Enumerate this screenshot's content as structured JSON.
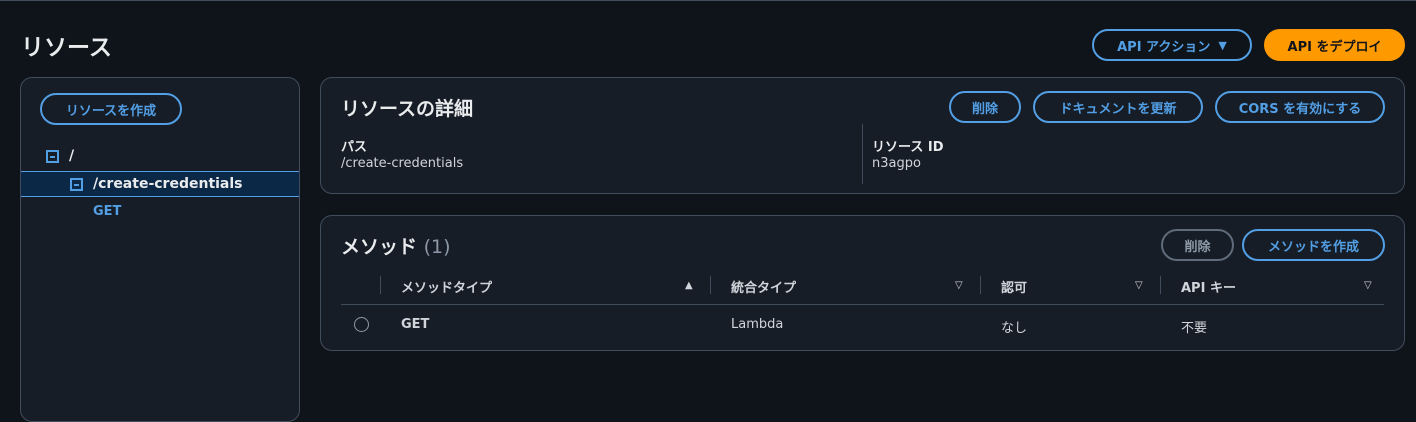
{
  "page": {
    "title": "リソース"
  },
  "actions": {
    "api_actions_label": "API アクション",
    "deploy_label": "API をデプロイ"
  },
  "sidebar": {
    "create_resource_label": "リソースを作成",
    "tree": [
      {
        "label": "/",
        "expandable": true
      },
      {
        "label": "/create-credentials",
        "expandable": true,
        "selected": true
      },
      {
        "label": "GET",
        "method": true
      }
    ]
  },
  "resource_details": {
    "title": "リソースの詳細",
    "delete_label": "削除",
    "update_docs_label": "ドキュメントを更新",
    "enable_cors_label": "CORS を有効にする",
    "path_label": "パス",
    "path_value": "/create-credentials",
    "resource_id_label": "リソース ID",
    "resource_id_value": "n3agpo"
  },
  "methods": {
    "title": "メソッド",
    "count": "(1)",
    "delete_label": "削除",
    "create_label": "メソッドを作成",
    "columns": [
      "メソッドタイプ",
      "統合タイプ",
      "認可",
      "API キー"
    ],
    "rows": [
      {
        "method_type": "GET",
        "integration_type": "Lambda",
        "authorization": "なし",
        "api_key": "不要"
      }
    ]
  },
  "colors": {
    "background": "#0f141a",
    "panel": "#161d26",
    "accent": "#539fe5",
    "primary": "#ff9900"
  }
}
